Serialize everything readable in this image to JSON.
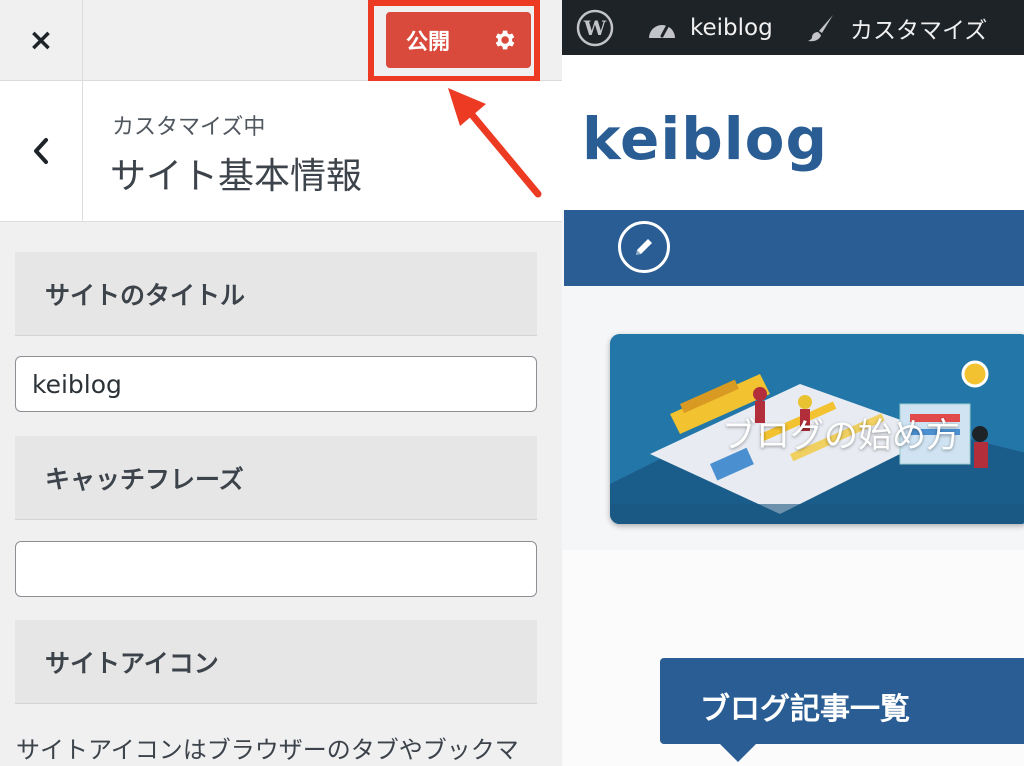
{
  "customizer": {
    "close_label": "×",
    "publish_label": "公開",
    "breadcrumb": "カスタマイズ中",
    "section_title": "サイト基本情報",
    "fields": [
      {
        "label": "サイトのタイトル",
        "value": "keiblog",
        "placeholder": ""
      },
      {
        "label": "キャッチフレーズ",
        "value": "",
        "placeholder": ""
      },
      {
        "label": "サイトアイコン"
      }
    ],
    "site_icon_description": "サイトアイコンはブラウザーのタブやブックマ"
  },
  "admin_bar": {
    "site_name": "keiblog",
    "customize_label": "カスタマイズ"
  },
  "preview": {
    "site_title": "keiblog",
    "banner_text": "ブログの始め方",
    "posts_heading": "ブログ記事一覧"
  },
  "colors": {
    "publish_button": "#d94a3c",
    "highlight": "#ec3b22",
    "theme_blue": "#2a5d94",
    "admin_bar": "#1d2327"
  },
  "icons": [
    "close-icon",
    "gear-icon",
    "chevron-left-icon",
    "wordpress-icon",
    "dashboard-icon",
    "paintbrush-icon",
    "pencil-icon"
  ]
}
